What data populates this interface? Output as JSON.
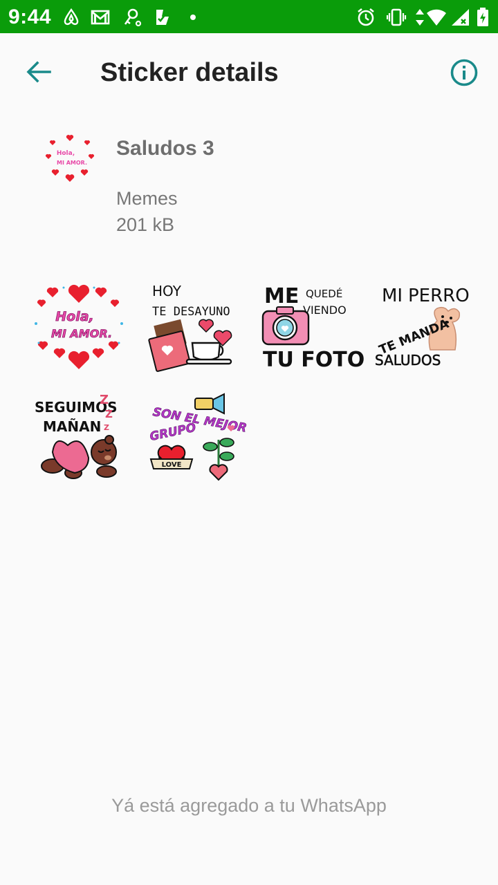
{
  "status_bar": {
    "time": "9:44",
    "background": "#0a9c0a",
    "notification_icons": [
      "airbnb-icon",
      "gmail-icon",
      "key-icon",
      "checklist-icon",
      "dot-icon"
    ],
    "system_icons": [
      "alarm-icon",
      "vibrate-icon",
      "data-arrows-icon",
      "wifi-icon",
      "signal-icon",
      "battery-icon"
    ]
  },
  "app_bar": {
    "title": "Sticker details",
    "back_icon": "arrow-back-icon",
    "info_icon": "info-icon",
    "accent_color": "#1a8a8a"
  },
  "pack": {
    "name": "Saludos 3",
    "publisher": "Memes",
    "size": "201 kB"
  },
  "stickers": [
    {
      "name": "hola-mi-amor",
      "lines": [
        "Hola,",
        "MI AMOR."
      ]
    },
    {
      "name": "hoy-te-desayuno",
      "lines": [
        "HOY",
        "TE DESAYUNO"
      ]
    },
    {
      "name": "me-quede-viendo",
      "lines": [
        "ME",
        "QUEDÉ",
        "VIENDO",
        "TU FOTO"
      ]
    },
    {
      "name": "mi-perro-te-manda",
      "lines": [
        "MI",
        "PERRO",
        "TE MANDA",
        "SALUDOS"
      ]
    },
    {
      "name": "seguimos-manana",
      "lines": [
        "SEGUIMOS",
        "MAÑAN",
        "Z",
        "Z",
        "Z"
      ]
    },
    {
      "name": "son-el-mejor-grupo",
      "lines": [
        "SON EL MEJOR",
        "GRUPO",
        "LOVE"
      ]
    }
  ],
  "footer": {
    "status_text": "Yá está agregado a tu WhatsApp"
  }
}
